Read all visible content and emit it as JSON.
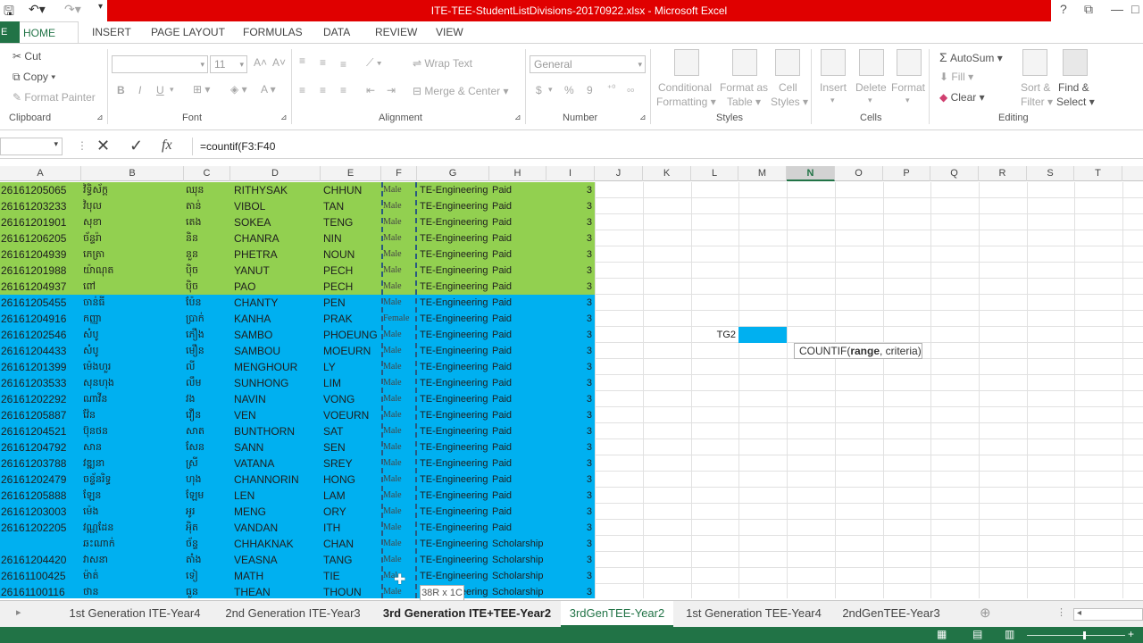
{
  "window": {
    "title": "ITE-TEE-StudentListDivisions-20170922.xlsx - Microsoft Excel",
    "help": "?",
    "restore": "⧉",
    "minimize": "—",
    "maximize": "□"
  },
  "ribbon_tabs": [
    "HOME",
    "INSERT",
    "PAGE LAYOUT",
    "FORMULAS",
    "DATA",
    "REVIEW",
    "VIEW"
  ],
  "file_tab": "E",
  "clipboard": {
    "cut": "Cut",
    "copy": "Copy",
    "format_painter": "Format Painter",
    "label": "Clipboard"
  },
  "font": {
    "name": "",
    "size": "11",
    "label": "Font",
    "bold": "B",
    "italic": "I",
    "underline": "U"
  },
  "alignment": {
    "wrap": "Wrap Text",
    "merge": "Merge & Center",
    "label": "Alignment"
  },
  "number": {
    "format": "General",
    "currency": "$",
    "percent": "%",
    "comma": "9",
    "label": "Number"
  },
  "styles": {
    "conditional": "Conditional",
    "conditional2": "Formatting",
    "format_as": "Format as",
    "format_as2": "Table",
    "cell": "Cell",
    "cell2": "Styles",
    "label": "Styles"
  },
  "cells": {
    "insert": "Insert",
    "delete": "Delete",
    "format": "Format",
    "label": "Cells"
  },
  "editing": {
    "autosum": "AutoSum",
    "fill": "Fill",
    "clear": "Clear",
    "sort": "Sort &",
    "sort2": "Filter",
    "find": "Find &",
    "find2": "Select",
    "label": "Editing"
  },
  "formula_bar": {
    "cancel": "✕",
    "enter": "✓",
    "fx": "fx",
    "formula": "=countif(F3:F40"
  },
  "columns": [
    "A",
    "B",
    "C",
    "D",
    "E",
    "F",
    "G",
    "H",
    "I",
    "J",
    "K",
    "L",
    "M",
    "N",
    "O",
    "P",
    "Q",
    "R",
    "S",
    "T"
  ],
  "rows": [
    {
      "id": "26161205065",
      "kh1": "វិទ្ធិស័ក្ត",
      "kh2": "ឈុន",
      "first": "RITHYSAK",
      "last": "CHHUN",
      "gender": "Male",
      "dept": "TE-Engineering",
      "status": "Paid",
      "n": "3",
      "color": "green"
    },
    {
      "id": "26161203233",
      "kh1": "វិបុល",
      "kh2": "តាន់",
      "first": "VIBOL",
      "last": "TAN",
      "gender": "Male",
      "dept": "TE-Engineering",
      "status": "Paid",
      "n": "3",
      "color": "green"
    },
    {
      "id": "26161201901",
      "kh1": "សុខា",
      "kh2": "តេង",
      "first": "SOKEA",
      "last": "TENG",
      "gender": "Male",
      "dept": "TE-Engineering",
      "status": "Paid",
      "n": "3",
      "color": "green"
    },
    {
      "id": "26161206205",
      "kh1": "ច័ន្ទរ៉ា",
      "kh2": "និន",
      "first": "CHANRA",
      "last": "NIN",
      "gender": "Male",
      "dept": "TE-Engineering",
      "status": "Paid",
      "n": "3",
      "color": "green"
    },
    {
      "id": "26161204939",
      "kh1": "ភេត្រា",
      "kh2": "នួន",
      "first": "PHETRA",
      "last": "NOUN",
      "gender": "Male",
      "dept": "TE-Engineering",
      "status": "Paid",
      "n": "3",
      "color": "green"
    },
    {
      "id": "26161201988",
      "kh1": "យ៉ាណុត",
      "kh2": "ប៉ិច",
      "first": "YANUT",
      "last": "PECH",
      "gender": "Male",
      "dept": "TE-Engineering",
      "status": "Paid",
      "n": "3",
      "color": "green"
    },
    {
      "id": "26161204937",
      "kh1": "ពៅ",
      "kh2": "ប៉ិច",
      "first": "PAO",
      "last": "PECH",
      "gender": "Male",
      "dept": "TE-Engineering",
      "status": "Paid",
      "n": "3",
      "color": "green"
    },
    {
      "id": "26161205455",
      "kh1": "ចាន់ធី",
      "kh2": "ប៉ែន",
      "first": "CHANTY",
      "last": "PEN",
      "gender": "Male",
      "dept": "TE-Engineering",
      "status": "Paid",
      "n": "3",
      "color": "blue"
    },
    {
      "id": "26161204916",
      "kh1": "កញ្ញា",
      "kh2": "ប្រាក់",
      "first": "KANHA",
      "last": "PRAK",
      "gender": "Female",
      "dept": "TE-Engineering",
      "status": "Paid",
      "n": "3",
      "color": "blue"
    },
    {
      "id": "26161202546",
      "kh1": "សំបូ",
      "kh2": "ភឿង",
      "first": "SAMBO",
      "last": "PHOEUNG",
      "gender": "Male",
      "dept": "TE-Engineering",
      "status": "Paid",
      "n": "3",
      "color": "blue"
    },
    {
      "id": "26161204433",
      "kh1": "សំបូ",
      "kh2": "មឿន",
      "first": "SAMBOU",
      "last": "MOEURN",
      "gender": "Male",
      "dept": "TE-Engineering",
      "status": "Paid",
      "n": "3",
      "color": "blue"
    },
    {
      "id": "26161201399",
      "kh1": "ម៉េងហួរ",
      "kh2": "លី",
      "first": "MENGHOUR",
      "last": "LY",
      "gender": "Male",
      "dept": "TE-Engineering",
      "status": "Paid",
      "n": "3",
      "color": "blue"
    },
    {
      "id": "26161203533",
      "kh1": "សុនហុង",
      "kh2": "លឹម",
      "first": "SUNHONG",
      "last": "LIM",
      "gender": "Male",
      "dept": "TE-Engineering",
      "status": "Paid",
      "n": "3",
      "color": "blue"
    },
    {
      "id": "26161202292",
      "kh1": "ណាវីន",
      "kh2": "វង",
      "first": "NAVIN",
      "last": "VONG",
      "gender": "Male",
      "dept": "TE-Engineering",
      "status": "Paid",
      "n": "3",
      "color": "blue"
    },
    {
      "id": "26161205887",
      "kh1": "វ៉ែន",
      "kh2": "វឿន",
      "first": "VEN",
      "last": "VOEURN",
      "gender": "Male",
      "dept": "TE-Engineering",
      "status": "Paid",
      "n": "3",
      "color": "blue"
    },
    {
      "id": "26161204521",
      "kh1": "ប៊ុនថន",
      "kh2": "សាត",
      "first": "BUNTHORN",
      "last": "SAT",
      "gender": "Male",
      "dept": "TE-Engineering",
      "status": "Paid",
      "n": "3",
      "color": "blue"
    },
    {
      "id": "26161204792",
      "kh1": "សាន",
      "kh2": "សែន",
      "first": "SANN",
      "last": "SEN",
      "gender": "Male",
      "dept": "TE-Engineering",
      "status": "Paid",
      "n": "3",
      "color": "blue"
    },
    {
      "id": "26161203788",
      "kh1": "វឌ្ឍនា",
      "kh2": "ស្រី",
      "first": "VATANA",
      "last": "SREY",
      "gender": "Male",
      "dept": "TE-Engineering",
      "status": "Paid",
      "n": "3",
      "color": "blue"
    },
    {
      "id": "26161202479",
      "kh1": "ចន្ទ័នរិទ្ធ",
      "kh2": "ហុង",
      "first": "CHANNORIN",
      "last": "HONG",
      "gender": "Male",
      "dept": "TE-Engineering",
      "status": "Paid",
      "n": "3",
      "color": "blue"
    },
    {
      "id": "26161205888",
      "kh1": "ឡែន",
      "kh2": "ឡែម",
      "first": "LEN",
      "last": "LAM",
      "gender": "Male",
      "dept": "TE-Engineering",
      "status": "Paid",
      "n": "3",
      "color": "blue"
    },
    {
      "id": "26161203003",
      "kh1": "ម៉េង",
      "kh2": "អូរ",
      "first": "MENG",
      "last": "ORY",
      "gender": "Male",
      "dept": "TE-Engineering",
      "status": "Paid",
      "n": "3",
      "color": "blue"
    },
    {
      "id": "26161202205",
      "kh1": "វណ្ណដែន",
      "kh2": "អុិត",
      "first": "VANDAN",
      "last": "ITH",
      "gender": "Male",
      "dept": "TE-Engineering",
      "status": "Paid",
      "n": "3",
      "color": "blue"
    },
    {
      "id": "",
      "kh1": "ឆះណាក់",
      "kh2": "ច័ន្ទ",
      "first": "CHHAKNAK",
      "last": "CHAN",
      "gender": "Male",
      "dept": "TE-Engineering",
      "status": "Scholarship",
      "n": "3",
      "color": "blue"
    },
    {
      "id": "26161204420",
      "kh1": "វាសនា",
      "kh2": "តាំង",
      "first": "VEASNA",
      "last": "TANG",
      "gender": "Male",
      "dept": "TE-Engineering",
      "status": "Scholarship",
      "n": "3",
      "color": "blue"
    },
    {
      "id": "26161100425",
      "kh1": "ម៉ាត់",
      "kh2": "ទៀ",
      "first": "MATH",
      "last": "TIE",
      "gender": "Male",
      "dept": "TE-Engineering",
      "status": "Scholarship",
      "n": "3",
      "color": "blue"
    },
    {
      "id": "26161100116",
      "kh1": "ថាន",
      "kh2": "ធួន",
      "first": "THEAN",
      "last": "THOUN",
      "gender": "Male",
      "dept": "TE-Engineering",
      "status": "Scholarship",
      "n": "3",
      "color": "blue"
    }
  ],
  "cell_l": {
    "text": "TG2"
  },
  "tooltip": {
    "fn": "COUNTIF(",
    "arg1": "range",
    "rest": ", criteria)"
  },
  "size_hint": "38R x 1C",
  "sheet_tabs": [
    {
      "label": "1st Generation ITE-Year4",
      "state": "normal"
    },
    {
      "label": "2nd Generation ITE-Year3",
      "state": "normal"
    },
    {
      "label": "3rd Generation ITE+TEE-Year2",
      "state": "bold"
    },
    {
      "label": "3rdGenTEE-Year2",
      "state": "active"
    },
    {
      "label": "1st Generation TEE-Year4",
      "state": "normal"
    },
    {
      "label": "2ndGenTEE-Year3",
      "state": "normal"
    }
  ],
  "colors": {
    "green": "#92d050",
    "blue": "#00b0f0",
    "excel_green": "#217346",
    "title_red": "#e00000"
  }
}
